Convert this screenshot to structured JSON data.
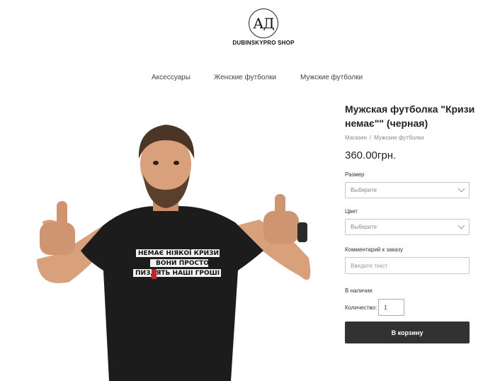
{
  "header": {
    "logo_mark": "АД",
    "logo_name": "DUBINSKYPRO SHOP"
  },
  "nav": {
    "items": [
      "Аксессуары",
      "Женские футболки",
      "Мужские футболки"
    ]
  },
  "product": {
    "title_line1": "Мужская футболка \"Кризи",
    "title_line2": "немає\"\" (черная)",
    "breadcrumb": {
      "home": "Магазин",
      "separator": "/",
      "category": "Мужские футболки"
    },
    "price": "360.00грн.",
    "size": {
      "label": "Размер",
      "placeholder": "Выберите"
    },
    "color": {
      "label": "Цвет",
      "placeholder": "Выберите"
    },
    "comment": {
      "label": "Комментарий к заказу",
      "placeholder": "Введите текст"
    },
    "stock_status": "В наличии",
    "quantity": {
      "label": "Количество:",
      "value": "1"
    },
    "cart_button": "В корзину",
    "shirt_print": [
      "НЕМАЄ НІЯКОЇ КРИЗИ",
      "ВОНИ ПРОСТО",
      "ПИЗДЯТЬ НАШІ ГРОШІ"
    ]
  },
  "colors": {
    "button_bg": "#323232",
    "text_dark": "#222222",
    "shirt": "#1c1c1c",
    "skin": "#d9a07c"
  }
}
